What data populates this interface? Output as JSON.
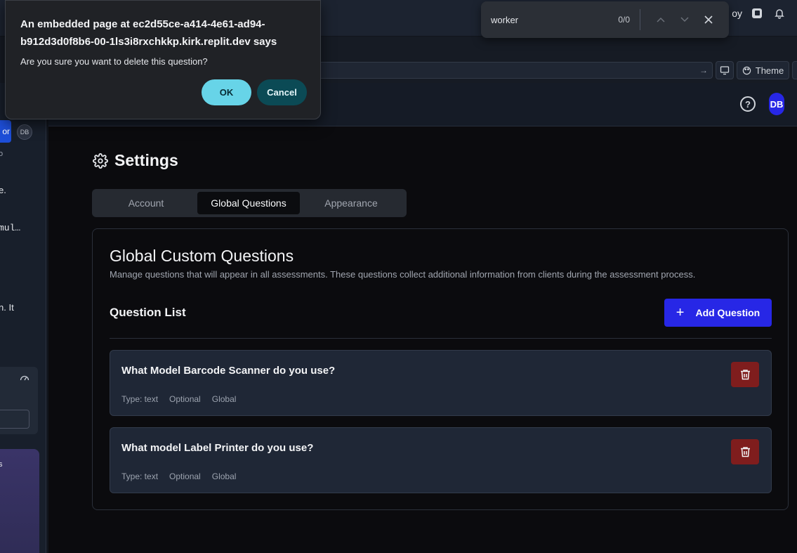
{
  "browser": {
    "deploy_partial": "oy",
    "theme_label": "Theme"
  },
  "find": {
    "query": "worker",
    "count": "0/0"
  },
  "sidebar": {
    "partials": [
      "o",
      "or",
      "o",
      "e.",
      "mul…",
      "n. It",
      "s"
    ],
    "avatar": "DB"
  },
  "header": {
    "avatar": "DB"
  },
  "settings": {
    "title": "Settings",
    "tabs": [
      "Account",
      "Global Questions",
      "Appearance"
    ],
    "active_tab": "Global Questions"
  },
  "card": {
    "title": "Global Custom Questions",
    "description": "Manage questions that will appear in all assessments. These questions collect additional information from clients during the assessment process.",
    "list_title": "Question List",
    "add_button": "Add Question"
  },
  "questions": [
    {
      "text": "What Model Barcode Scanner do you use?",
      "type": "Type: text",
      "required": "Optional",
      "scope": "Global"
    },
    {
      "text": "What model Label Printer do you use?",
      "type": "Type: text",
      "required": "Optional",
      "scope": "Global"
    }
  ],
  "dialog": {
    "title": "An embedded page at ec2d55ce-a414-4e61-ad94-b912d3d0f8b6-00-1ls3i8rxchkkp.kirk.replit.dev says",
    "message": "Are you sure you want to delete this question?",
    "ok": "OK",
    "cancel": "Cancel"
  },
  "colors": {
    "primary": "#2727e6",
    "danger": "#7f1d1d",
    "dialog_ok": "#67d4e8",
    "dialog_cancel": "#0b4a55"
  }
}
